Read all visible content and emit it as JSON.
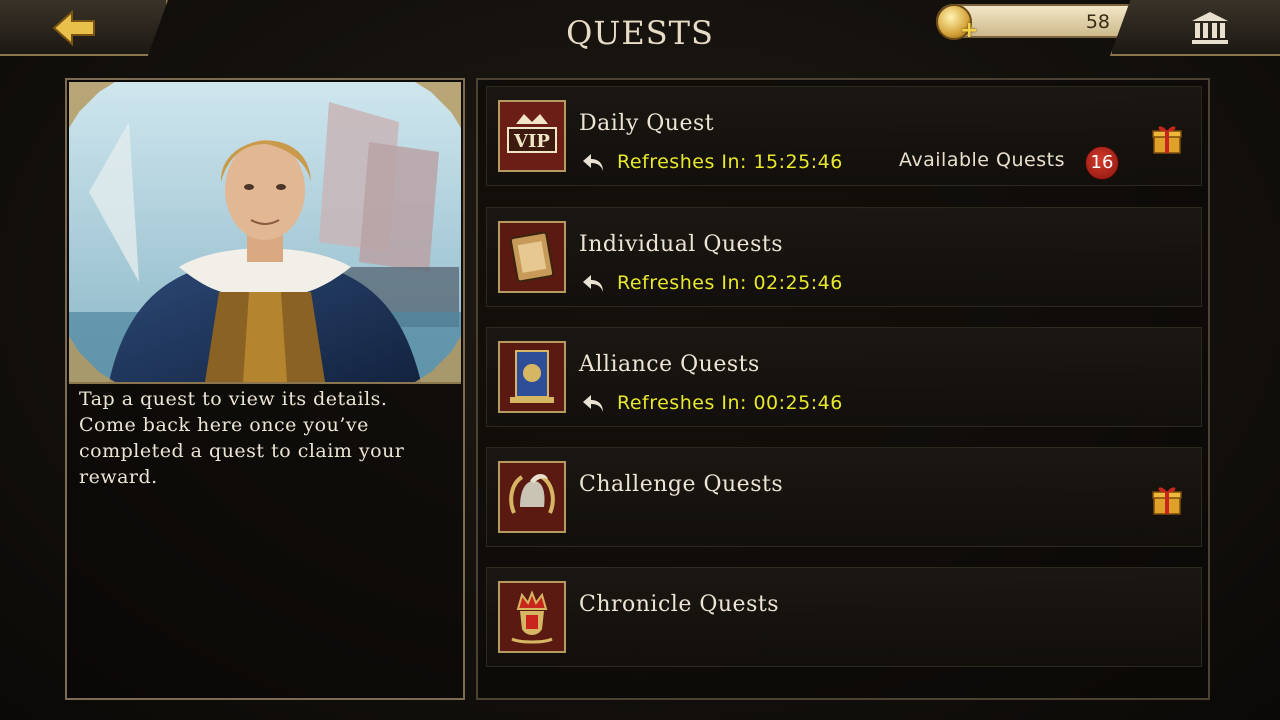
{
  "header": {
    "title": "QUESTS",
    "coins": "58"
  },
  "left_panel": {
    "description": "Tap a quest to view its details. Come back here once you’ve completed a quest to claim your reward."
  },
  "quests": [
    {
      "title": "Daily Quest",
      "refresh": "Refreshes In: 15:25:46",
      "available_label": "Available Quests",
      "available_count": "16",
      "gift": true,
      "icon": "vip-crown-icon"
    },
    {
      "title": "Individual Quests",
      "refresh": "Refreshes In: 02:25:46",
      "gift": false,
      "icon": "book-icon"
    },
    {
      "title": "Alliance Quests",
      "refresh": "Refreshes In: 00:25:46",
      "gift": false,
      "icon": "alliance-banner-icon"
    },
    {
      "title": "Challenge Quests",
      "gift": true,
      "icon": "helmet-laurel-icon"
    },
    {
      "title": "Chronicle Quests",
      "gift": false,
      "icon": "crown-crest-icon"
    }
  ],
  "colors": {
    "timer_yellow": "#e7e82a",
    "badge_red": "#b3201a",
    "frame_gold": "#b59a62"
  }
}
